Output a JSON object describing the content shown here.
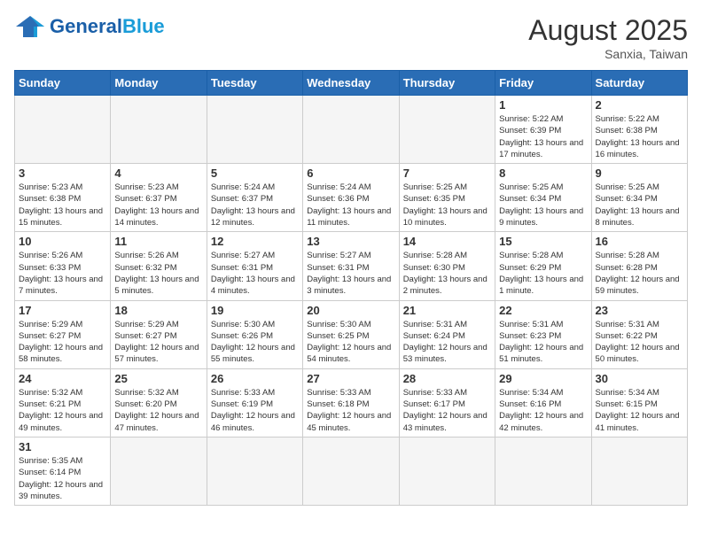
{
  "logo": {
    "text_general": "General",
    "text_blue": "Blue"
  },
  "header": {
    "month_year": "August 2025",
    "location": "Sanxia, Taiwan"
  },
  "days_of_week": [
    "Sunday",
    "Monday",
    "Tuesday",
    "Wednesday",
    "Thursday",
    "Friday",
    "Saturday"
  ],
  "weeks": [
    [
      {
        "day": "",
        "info": ""
      },
      {
        "day": "",
        "info": ""
      },
      {
        "day": "",
        "info": ""
      },
      {
        "day": "",
        "info": ""
      },
      {
        "day": "",
        "info": ""
      },
      {
        "day": "1",
        "info": "Sunrise: 5:22 AM\nSunset: 6:39 PM\nDaylight: 13 hours and 17 minutes."
      },
      {
        "day": "2",
        "info": "Sunrise: 5:22 AM\nSunset: 6:38 PM\nDaylight: 13 hours and 16 minutes."
      }
    ],
    [
      {
        "day": "3",
        "info": "Sunrise: 5:23 AM\nSunset: 6:38 PM\nDaylight: 13 hours and 15 minutes."
      },
      {
        "day": "4",
        "info": "Sunrise: 5:23 AM\nSunset: 6:37 PM\nDaylight: 13 hours and 14 minutes."
      },
      {
        "day": "5",
        "info": "Sunrise: 5:24 AM\nSunset: 6:37 PM\nDaylight: 13 hours and 12 minutes."
      },
      {
        "day": "6",
        "info": "Sunrise: 5:24 AM\nSunset: 6:36 PM\nDaylight: 13 hours and 11 minutes."
      },
      {
        "day": "7",
        "info": "Sunrise: 5:25 AM\nSunset: 6:35 PM\nDaylight: 13 hours and 10 minutes."
      },
      {
        "day": "8",
        "info": "Sunrise: 5:25 AM\nSunset: 6:34 PM\nDaylight: 13 hours and 9 minutes."
      },
      {
        "day": "9",
        "info": "Sunrise: 5:25 AM\nSunset: 6:34 PM\nDaylight: 13 hours and 8 minutes."
      }
    ],
    [
      {
        "day": "10",
        "info": "Sunrise: 5:26 AM\nSunset: 6:33 PM\nDaylight: 13 hours and 7 minutes."
      },
      {
        "day": "11",
        "info": "Sunrise: 5:26 AM\nSunset: 6:32 PM\nDaylight: 13 hours and 5 minutes."
      },
      {
        "day": "12",
        "info": "Sunrise: 5:27 AM\nSunset: 6:31 PM\nDaylight: 13 hours and 4 minutes."
      },
      {
        "day": "13",
        "info": "Sunrise: 5:27 AM\nSunset: 6:31 PM\nDaylight: 13 hours and 3 minutes."
      },
      {
        "day": "14",
        "info": "Sunrise: 5:28 AM\nSunset: 6:30 PM\nDaylight: 13 hours and 2 minutes."
      },
      {
        "day": "15",
        "info": "Sunrise: 5:28 AM\nSunset: 6:29 PM\nDaylight: 13 hours and 1 minute."
      },
      {
        "day": "16",
        "info": "Sunrise: 5:28 AM\nSunset: 6:28 PM\nDaylight: 12 hours and 59 minutes."
      }
    ],
    [
      {
        "day": "17",
        "info": "Sunrise: 5:29 AM\nSunset: 6:27 PM\nDaylight: 12 hours and 58 minutes."
      },
      {
        "day": "18",
        "info": "Sunrise: 5:29 AM\nSunset: 6:27 PM\nDaylight: 12 hours and 57 minutes."
      },
      {
        "day": "19",
        "info": "Sunrise: 5:30 AM\nSunset: 6:26 PM\nDaylight: 12 hours and 55 minutes."
      },
      {
        "day": "20",
        "info": "Sunrise: 5:30 AM\nSunset: 6:25 PM\nDaylight: 12 hours and 54 minutes."
      },
      {
        "day": "21",
        "info": "Sunrise: 5:31 AM\nSunset: 6:24 PM\nDaylight: 12 hours and 53 minutes."
      },
      {
        "day": "22",
        "info": "Sunrise: 5:31 AM\nSunset: 6:23 PM\nDaylight: 12 hours and 51 minutes."
      },
      {
        "day": "23",
        "info": "Sunrise: 5:31 AM\nSunset: 6:22 PM\nDaylight: 12 hours and 50 minutes."
      }
    ],
    [
      {
        "day": "24",
        "info": "Sunrise: 5:32 AM\nSunset: 6:21 PM\nDaylight: 12 hours and 49 minutes."
      },
      {
        "day": "25",
        "info": "Sunrise: 5:32 AM\nSunset: 6:20 PM\nDaylight: 12 hours and 47 minutes."
      },
      {
        "day": "26",
        "info": "Sunrise: 5:33 AM\nSunset: 6:19 PM\nDaylight: 12 hours and 46 minutes."
      },
      {
        "day": "27",
        "info": "Sunrise: 5:33 AM\nSunset: 6:18 PM\nDaylight: 12 hours and 45 minutes."
      },
      {
        "day": "28",
        "info": "Sunrise: 5:33 AM\nSunset: 6:17 PM\nDaylight: 12 hours and 43 minutes."
      },
      {
        "day": "29",
        "info": "Sunrise: 5:34 AM\nSunset: 6:16 PM\nDaylight: 12 hours and 42 minutes."
      },
      {
        "day": "30",
        "info": "Sunrise: 5:34 AM\nSunset: 6:15 PM\nDaylight: 12 hours and 41 minutes."
      }
    ],
    [
      {
        "day": "31",
        "info": "Sunrise: 5:35 AM\nSunset: 6:14 PM\nDaylight: 12 hours and 39 minutes."
      },
      {
        "day": "",
        "info": ""
      },
      {
        "day": "",
        "info": ""
      },
      {
        "day": "",
        "info": ""
      },
      {
        "day": "",
        "info": ""
      },
      {
        "day": "",
        "info": ""
      },
      {
        "day": "",
        "info": ""
      }
    ]
  ]
}
